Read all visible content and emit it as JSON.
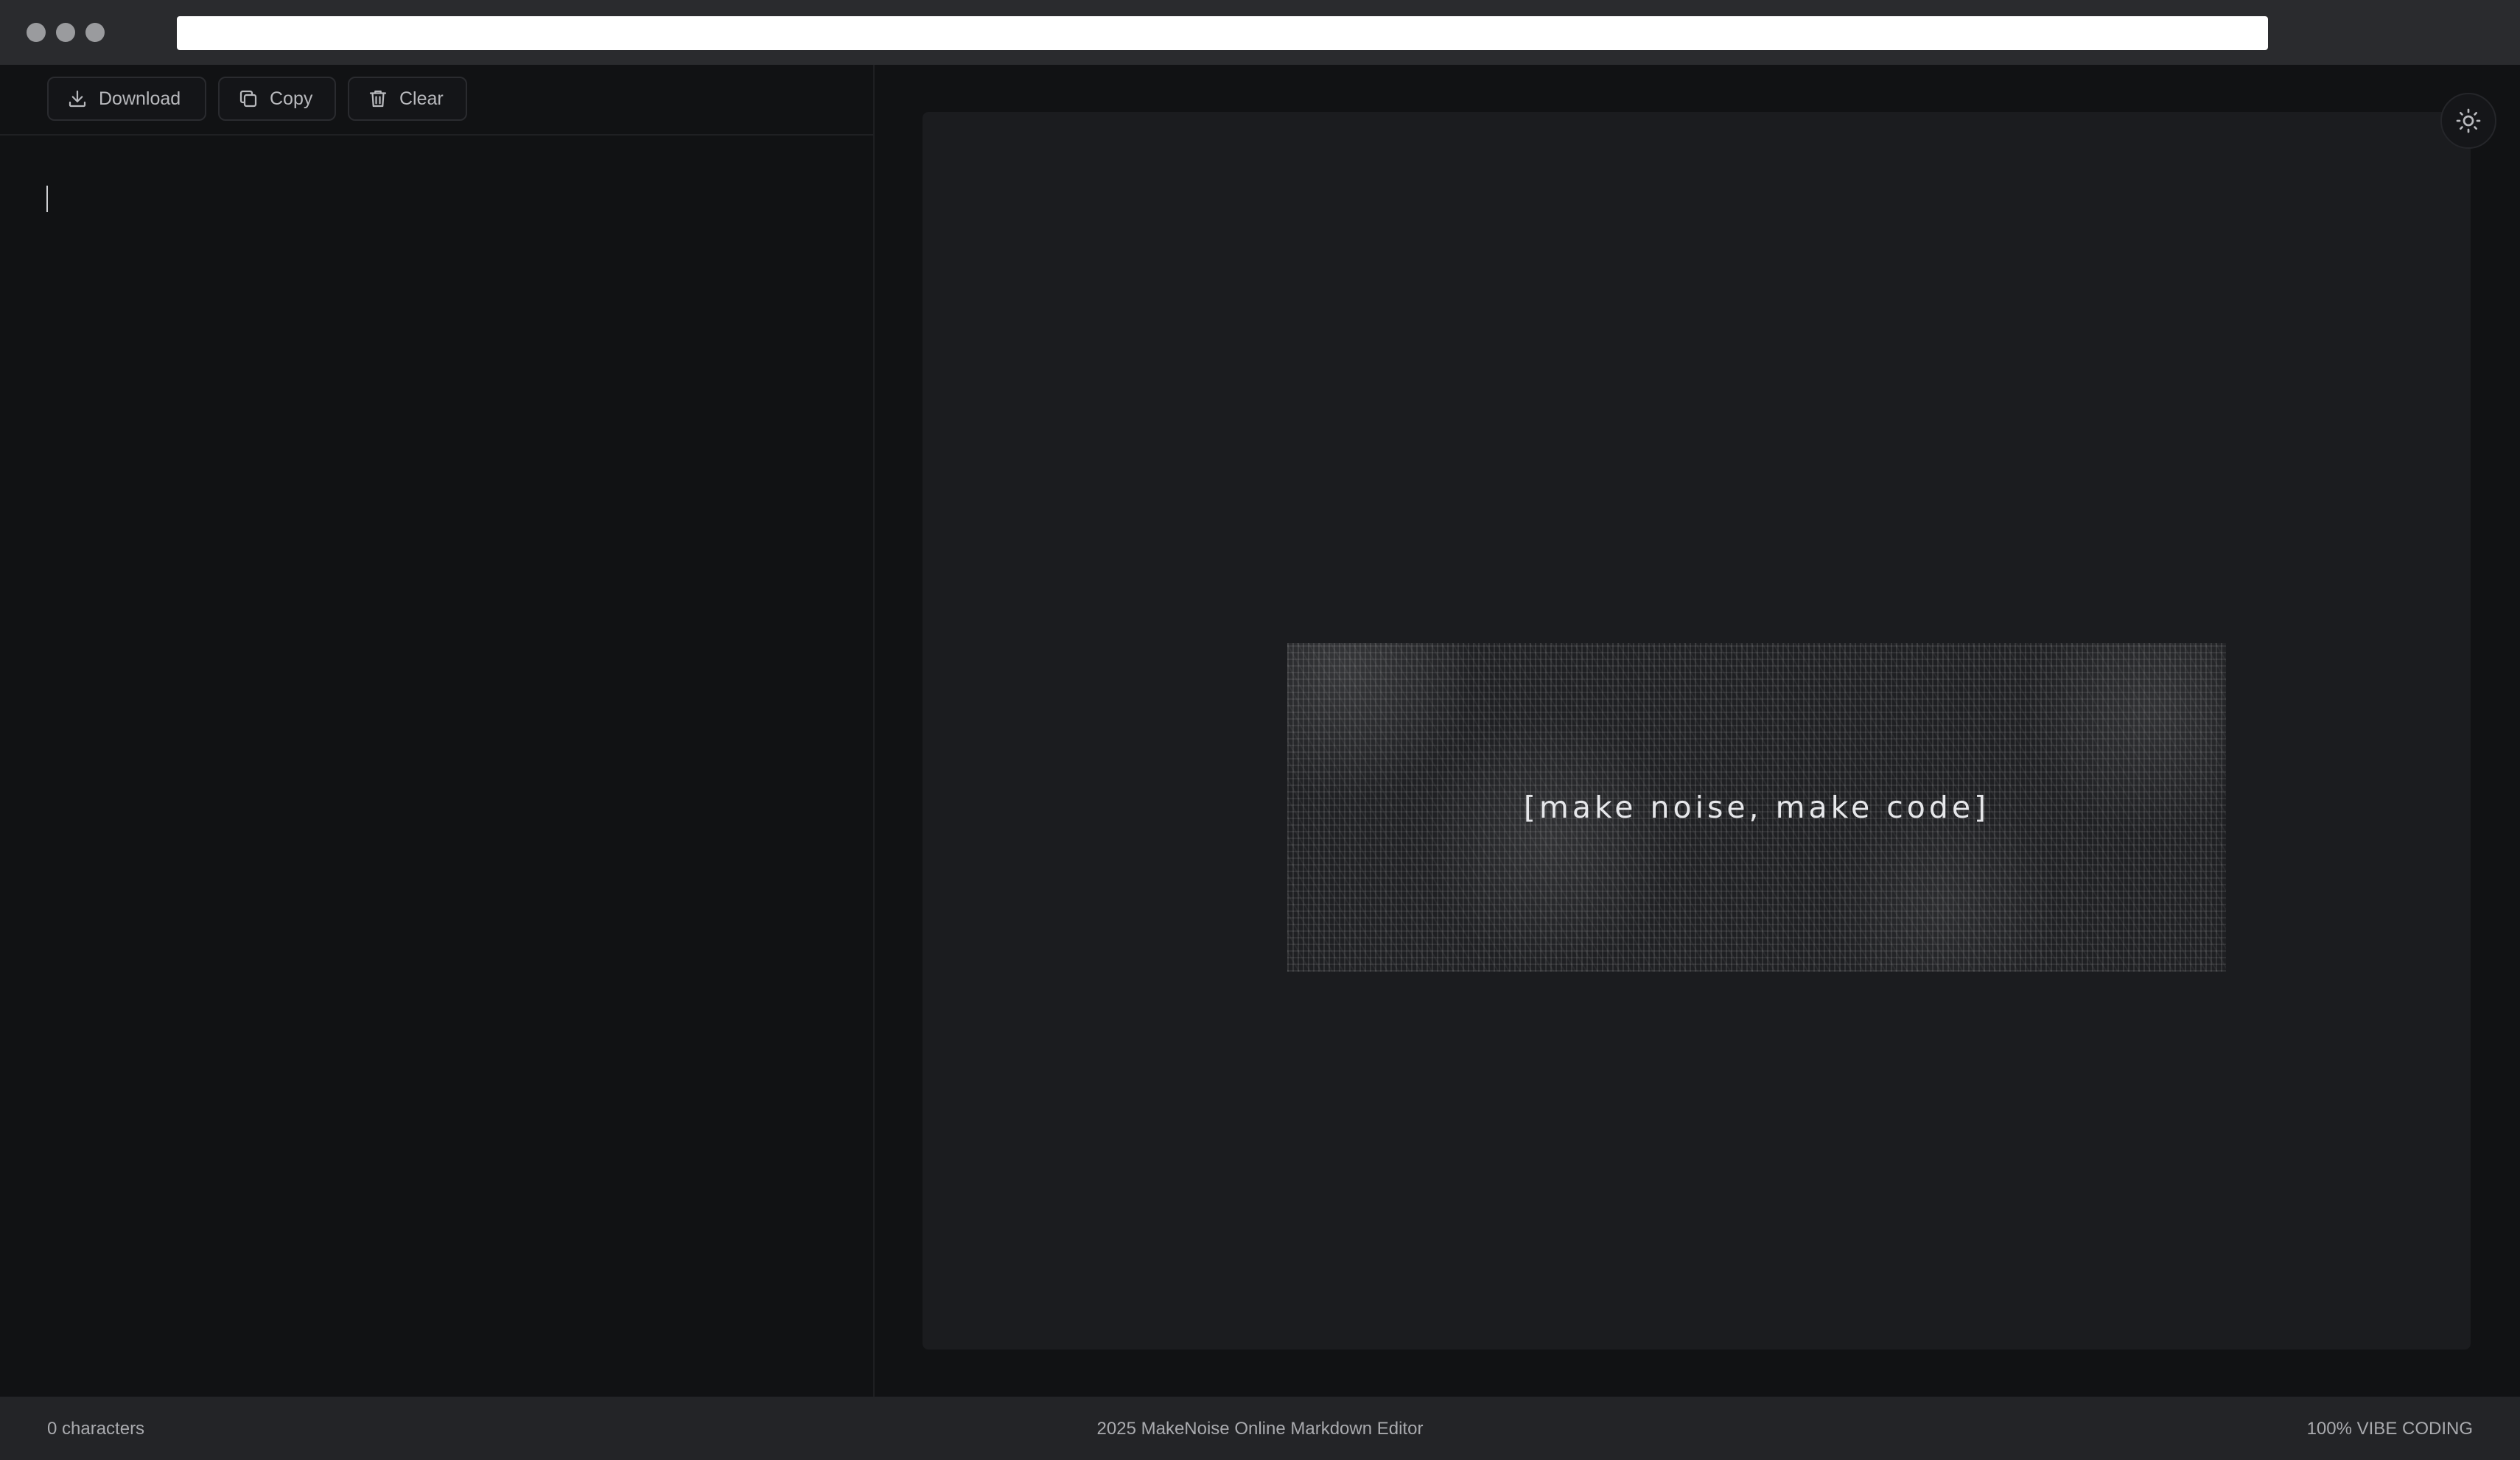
{
  "browser": {
    "url": ""
  },
  "toolbar": {
    "download_label": "Download",
    "copy_label": "Copy",
    "clear_label": "Clear"
  },
  "editor": {
    "content": ""
  },
  "preview": {
    "banner_text": "[make noise, make code]"
  },
  "footer": {
    "character_count": "0 characters",
    "app_title": "2025 MakeNoise Online Markdown Editor",
    "tagline": "100% VIBE CODING"
  },
  "icons": {
    "download": "download-icon",
    "copy": "copy-icon",
    "clear": "trash-icon",
    "theme": "sun-icon"
  },
  "colors": {
    "background": "#111214",
    "preview_card": "#1b1c1f",
    "footer": "#232427",
    "text_muted": "#a9aaae"
  }
}
